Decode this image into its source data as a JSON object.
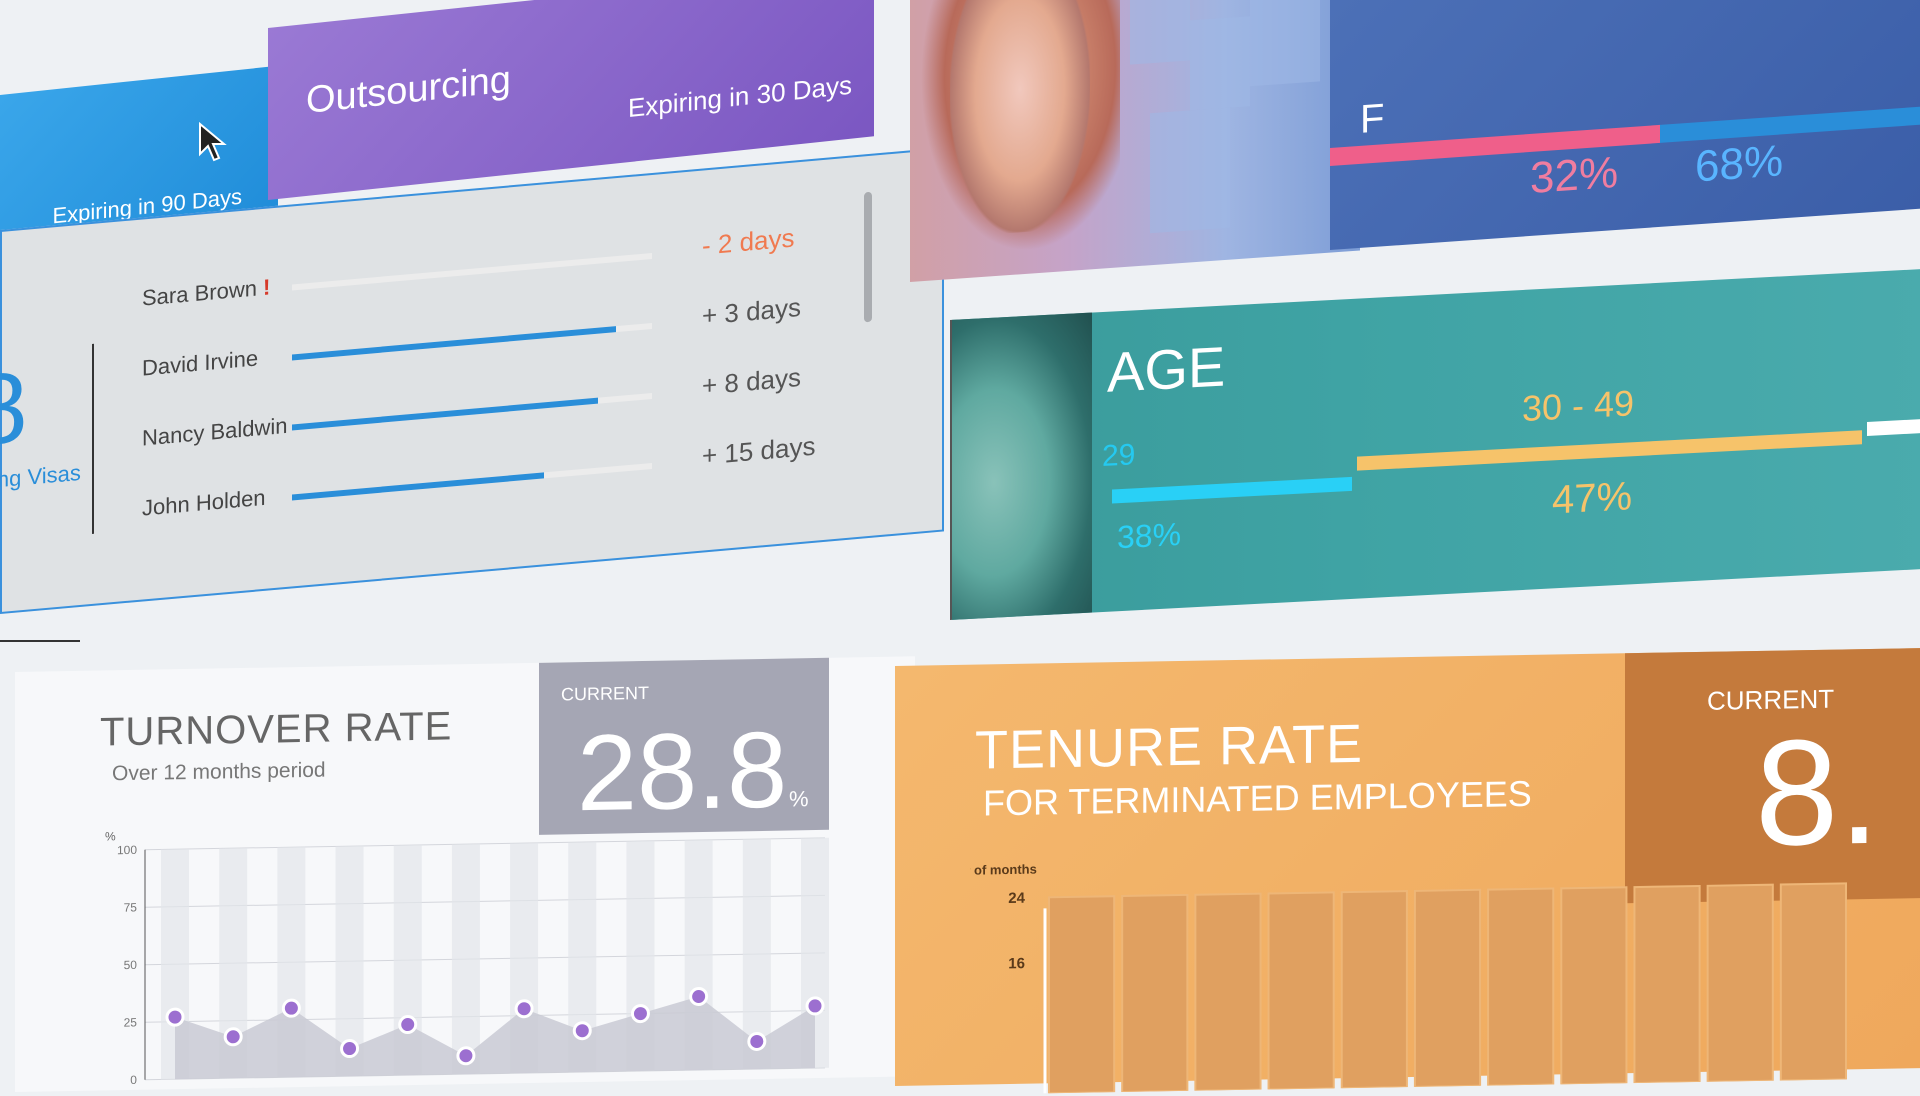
{
  "visa": {
    "blue_tab": {
      "expiring": "Expiring in 90 Days"
    },
    "purple_tab": {
      "title": "Outsourcing",
      "expiring": "Expiring in 30 Days"
    },
    "count": "8",
    "count_label": "ing Visas",
    "rows": [
      {
        "name": "Sara Brown",
        "alert": "!",
        "progress": 0,
        "days": "- 2 days"
      },
      {
        "name": "David Irvine",
        "alert": "",
        "progress": 0.9,
        "days": "+ 3 days"
      },
      {
        "name": "Nancy Baldwin",
        "alert": "",
        "progress": 0.85,
        "days": "+ 8 days"
      },
      {
        "name": "John Holden",
        "alert": "",
        "progress": 0.7,
        "days": "+ 15 days"
      }
    ]
  },
  "gender": {
    "letter": "F",
    "female_pct": "32%",
    "male_pct": "68%",
    "colors": {
      "female": "#ef5f8a",
      "male": "#2a8ed9"
    }
  },
  "age": {
    "title": "AGE",
    "low_label": "29",
    "low_pct": "38%",
    "mid_label": "30 - 49",
    "mid_pct": "47%"
  },
  "turnover": {
    "title": "TURNOVER RATE",
    "subtitle": "Over 12 months period",
    "current_label": "CURRENT",
    "current_value": "28.8",
    "current_unit": "%"
  },
  "tenure": {
    "title": "TENURE RATE",
    "subtitle": "FOR TERMINATED EMPLOYEES",
    "current_label": "CURRENT",
    "current_value": "8."
  },
  "chart_data": [
    {
      "type": "area",
      "ylabel": "%",
      "ylim": [
        0,
        100
      ],
      "yticks": [
        "100",
        "75",
        "50",
        "25",
        "0"
      ],
      "values": [
        27,
        18,
        30,
        12,
        22,
        8,
        28,
        18,
        25,
        32,
        12,
        27
      ],
      "colors": {
        "area": "#c9cad3",
        "point": "#9c6fd0"
      }
    },
    {
      "type": "bar",
      "ylabel": "# of months",
      "yticks": [
        "24",
        "16"
      ],
      "values": [
        24,
        24,
        24,
        24,
        24,
        24,
        24,
        24,
        24,
        24,
        24
      ],
      "colors": {
        "bar": "#e0a060"
      }
    }
  ]
}
